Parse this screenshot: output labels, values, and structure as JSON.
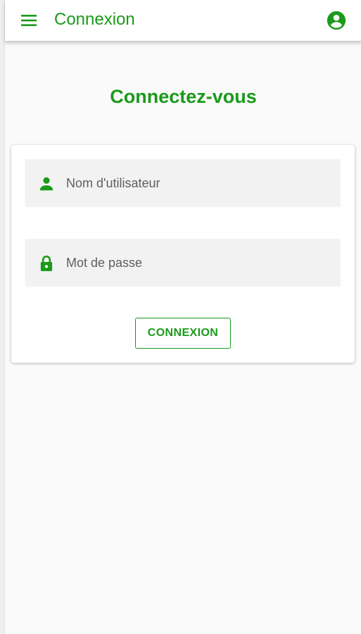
{
  "toolbar": {
    "title": "Connexion",
    "menu_icon": "menu-icon",
    "account_icon": "account-circle-icon"
  },
  "main": {
    "heading": "Connectez-vous"
  },
  "form": {
    "username": {
      "icon": "person-icon",
      "placeholder": "Nom d'utilisateur",
      "value": ""
    },
    "password": {
      "icon": "lock-icon",
      "placeholder": "Mot de passe",
      "value": ""
    },
    "submit_label": "CONNEXION"
  },
  "colors": {
    "accent": "#1a9a1a",
    "field_background": "#f2f2f2",
    "page_background": "#fafafa"
  }
}
